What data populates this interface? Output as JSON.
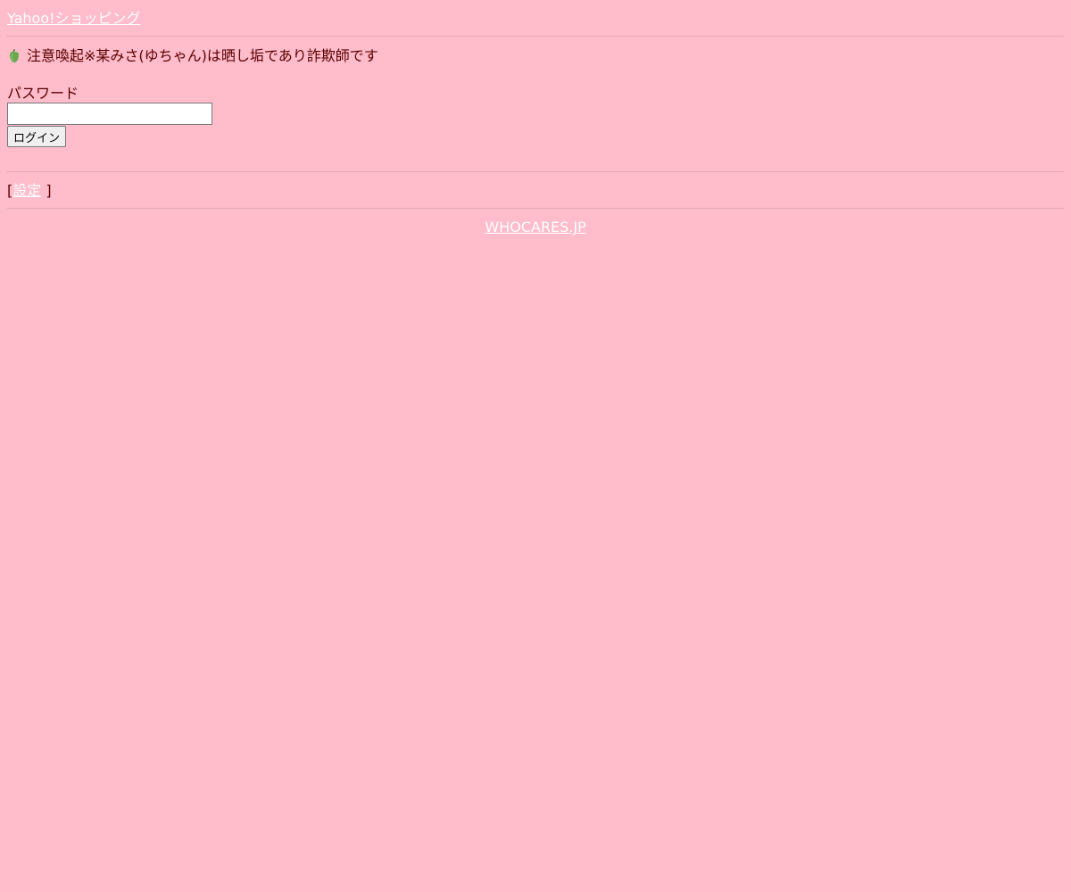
{
  "header": {
    "link_label": "Yahoo!ショッピング"
  },
  "notice": {
    "icon": "green-pepper-icon",
    "text": "注意喚起※某みさ(ゆちゃん)は晒し垢であり詐欺師です"
  },
  "login": {
    "password_label": "パスワード",
    "password_value": "",
    "submit_label": "ログイン"
  },
  "settings": {
    "open_bracket": "[",
    "link_label": "設定",
    "close_bracket": " ]"
  },
  "footer": {
    "link_label": "WHOCARES.JP"
  },
  "colors": {
    "background": "#ffbccb",
    "text": "#5a0000",
    "link": "#ffffff",
    "divider": "#e3a9b5"
  }
}
